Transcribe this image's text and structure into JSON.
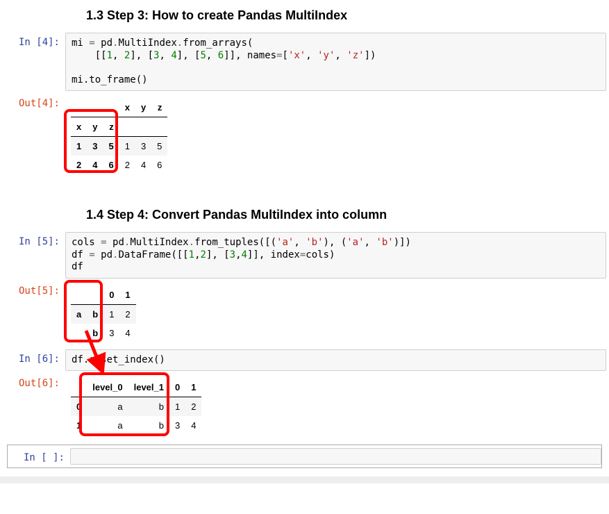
{
  "headings": {
    "h13": "1.3  Step 3: How to create Pandas MultiIndex",
    "h14": "1.4  Step 4: Convert Pandas MultiIndex into column"
  },
  "prompts": {
    "in4": "In [4]:",
    "out4": "Out[4]:",
    "in5": "In [5]:",
    "out5": "Out[5]:",
    "in6": "In [6]:",
    "out6": "Out[6]:",
    "in_empty": "In [ ]:"
  },
  "code": {
    "c4_l1a": "mi ",
    "c4_l1b": "=",
    "c4_l1c": " pd",
    "c4_l1d": ".",
    "c4_l1e": "MultiIndex",
    "c4_l1f": ".",
    "c4_l1g": "from_arrays(",
    "c4_l2a": "    [[",
    "c4_l2b": "1",
    "c4_l2c": ", ",
    "c4_l2d": "2",
    "c4_l2e": "], [",
    "c4_l2f": "3",
    "c4_l2g": ", ",
    "c4_l2h": "4",
    "c4_l2i": "], [",
    "c4_l2j": "5",
    "c4_l2k": ", ",
    "c4_l2l": "6",
    "c4_l2m": "]], names",
    "c4_l2n": "=",
    "c4_l2o": "[",
    "c4_l2p": "'x'",
    "c4_l2q": ", ",
    "c4_l2r": "'y'",
    "c4_l2s": ", ",
    "c4_l2t": "'z'",
    "c4_l2u": "])",
    "c4_l4": "mi.to_frame()",
    "c5_l1a": "cols ",
    "c5_l1b": "=",
    "c5_l1c": " pd",
    "c5_l1d": ".",
    "c5_l1e": "MultiIndex",
    "c5_l1f": ".",
    "c5_l1g": "from_tuples([(",
    "c5_l1h": "'a'",
    "c5_l1i": ", ",
    "c5_l1j": "'b'",
    "c5_l1k": "), (",
    "c5_l1l": "'a'",
    "c5_l1m": ", ",
    "c5_l1n": "'b'",
    "c5_l1o": ")])",
    "c5_l2a": "df ",
    "c5_l2b": "=",
    "c5_l2c": " pd",
    "c5_l2d": ".",
    "c5_l2e": "DataFrame([[",
    "c5_l2f": "1",
    "c5_l2g": ",",
    "c5_l2h": "2",
    "c5_l2i": "], [",
    "c5_l2j": "3",
    "c5_l2k": ",",
    "c5_l2l": "4",
    "c5_l2m": "]], index",
    "c5_l2n": "=",
    "c5_l2o": "cols)",
    "c5_l3": "df",
    "c6": "df.reset_index()"
  },
  "out4": {
    "col_x": "x",
    "col_y": "y",
    "col_z": "z",
    "idx_x": "x",
    "idx_y": "y",
    "idx_z": "z",
    "r0_ix": "1",
    "r0_iy": "3",
    "r0_iz": "5",
    "r0_x": "1",
    "r0_y": "3",
    "r0_z": "5",
    "r1_ix": "2",
    "r1_iy": "4",
    "r1_iz": "6",
    "r1_x": "2",
    "r1_y": "4",
    "r1_z": "6"
  },
  "out5": {
    "col0": "0",
    "col1": "1",
    "r0_a": "a",
    "r0_b": "b",
    "r0_0": "1",
    "r0_1": "2",
    "r1_a": "",
    "r1_b": "b",
    "r1_0": "3",
    "r1_1": "4"
  },
  "out6": {
    "col_l0": "level_0",
    "col_l1": "level_1",
    "col0": "0",
    "col1": "1",
    "r0_i": "0",
    "r0_l0": "a",
    "r0_l1": "b",
    "r0_0": "1",
    "r0_1": "2",
    "r1_i": "1",
    "r1_l0": "a",
    "r1_l1": "b",
    "r1_0": "3",
    "r1_1": "4"
  }
}
